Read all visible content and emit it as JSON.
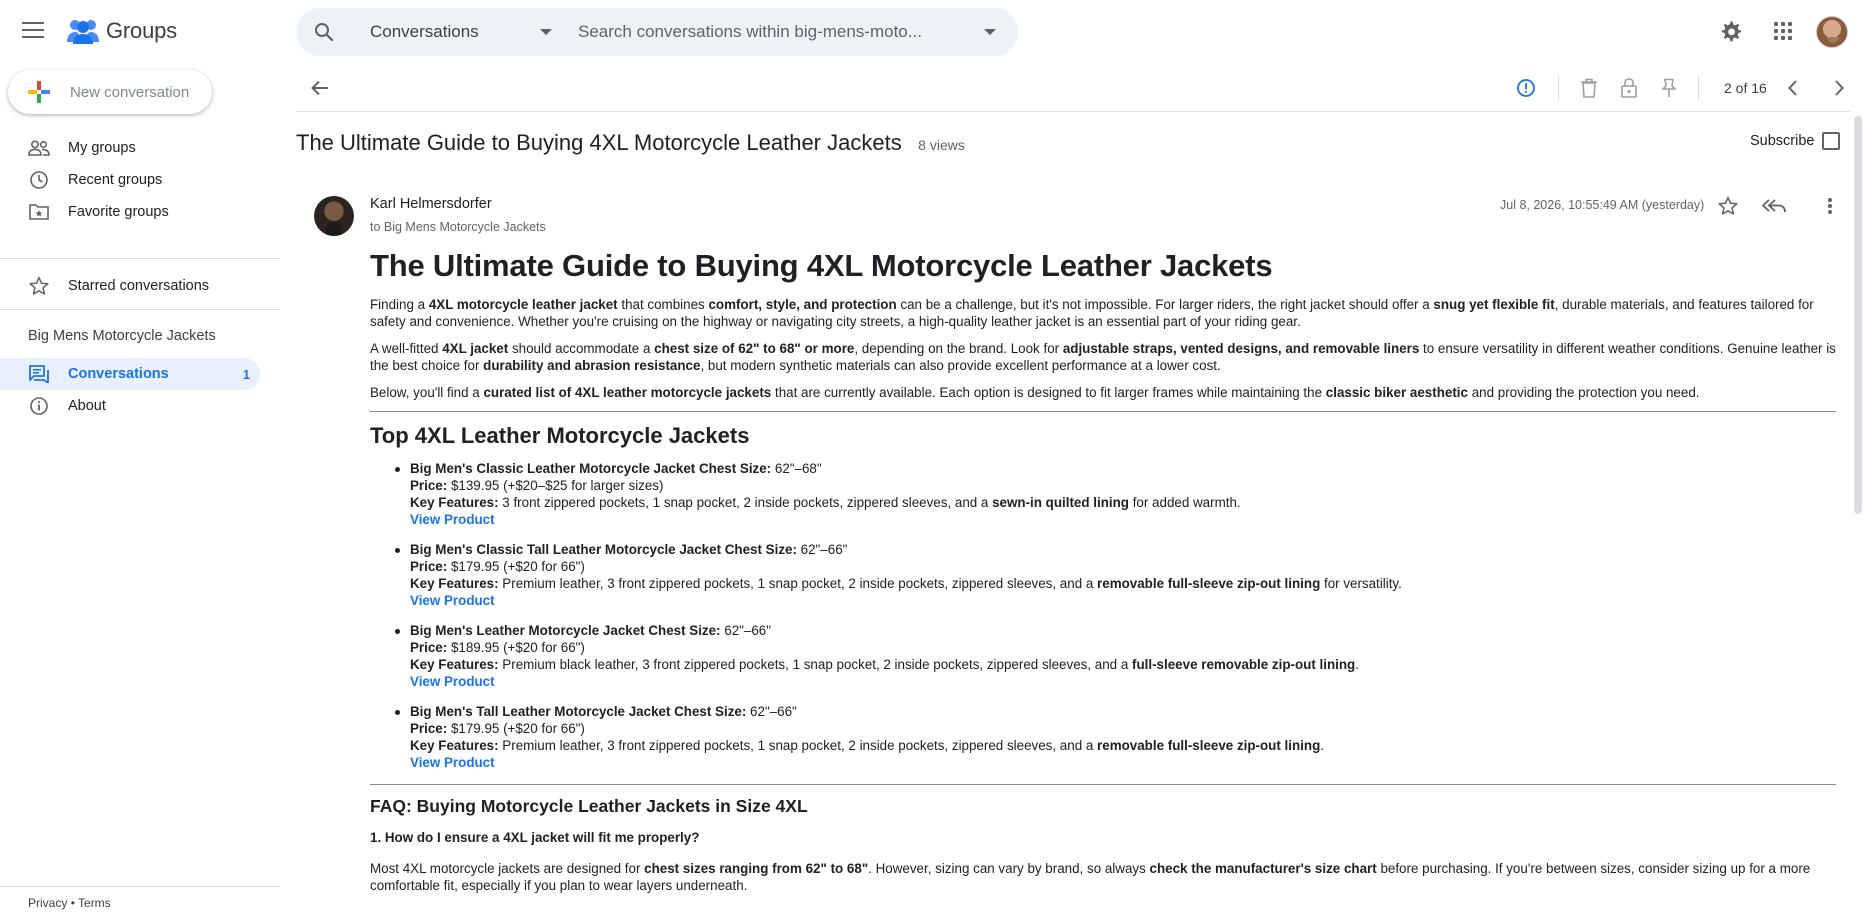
{
  "app": {
    "name": "Groups"
  },
  "search": {
    "scope": "Conversations",
    "placeholder": "Search conversations within big-mens-moto..."
  },
  "sidebar": {
    "new_conversation": "New conversation",
    "items": [
      {
        "label": "My groups",
        "icon": "people-icon"
      },
      {
        "label": "Recent groups",
        "icon": "clock-icon"
      },
      {
        "label": "Favorite groups",
        "icon": "folder-star-icon"
      },
      {
        "label": "Starred conversations",
        "icon": "star-icon"
      }
    ],
    "group_name": "Big Mens Motorcycle Jackets",
    "conversations_label": "Conversations",
    "conversations_count": "1",
    "about_label": "About",
    "footer": {
      "privacy": "Privacy",
      "sep": "•",
      "terms": "Terms"
    }
  },
  "toolbar": {
    "pager": "2 of 16"
  },
  "conversation": {
    "title": "The Ultimate Guide to Buying 4XL Motorcycle Leather Jackets",
    "views": "8 views",
    "subscribe": "Subscribe"
  },
  "message": {
    "author": "Karl Helmersdorfer",
    "to": "to Big Mens Motorcycle Jackets",
    "date": "Jul 8, 2026, 10:55:49 AM (yesterday)",
    "heading": "The Ultimate Guide to Buying 4XL Motorcycle Leather Jackets",
    "p1": {
      "a": "Finding a ",
      "b": "4XL motorcycle leather jacket",
      "c": " that combines ",
      "d": "comfort, style, and protection",
      "e": " can be a challenge, but it's not impossible. For larger riders, the right jacket should offer a ",
      "f": "snug yet flexible fit",
      "g": ", durable materials, and features tailored for safety and convenience. Whether you're cruising on the highway or navigating city streets, a high-quality leather jacket is an essential part of your riding gear."
    },
    "p2": {
      "a": "A well-fitted ",
      "b": "4XL jacket",
      "c": " should accommodate a ",
      "d": "chest size of 62\" to 68\" or more",
      "e": ", depending on the brand. Look for ",
      "f": "adjustable straps, vented designs, and removable liners",
      "g": " to ensure versatility in different weather conditions. Genuine leather is the best choice for ",
      "h": "durability and abrasion resistance",
      "i": ", but modern synthetic materials can also provide excellent performance at a lower cost."
    },
    "p3": {
      "a": "Below, you'll find a ",
      "b": "curated list of 4XL leather motorcycle jackets",
      "c": " that are currently available. Each option is designed to fit larger frames while maintaining the ",
      "d": "classic biker aesthetic",
      "e": " and providing the protection you need."
    },
    "section_title": "Top 4XL Leather Motorcycle Jackets",
    "price_label": "Price:",
    "features_label": "Key Features:",
    "view_product": "View Product",
    "products": [
      {
        "name": "Big Men's Classic Leather Motorcycle Jacket Chest Size:",
        "size": " 62\"–68\"",
        "price": " $139.95 (+$20–$25 for larger sizes)",
        "features": " 3 front zippered pockets, 1 snap pocket, 2 inside pockets, zippered sleeves, and a ",
        "highlight": "sewn-in quilted lining",
        "tail": " for added warmth."
      },
      {
        "name": "Big Men's Classic Tall Leather Motorcycle Jacket Chest Size:",
        "size": " 62\"–66\"",
        "price": " $179.95 (+$20 for 66\")",
        "features": " Premium leather, 3 front zippered pockets, 1 snap pocket, 2 inside pockets, zippered sleeves, and a ",
        "highlight": "removable full-sleeve zip-out lining",
        "tail": " for versatility."
      },
      {
        "name": "Big Men's Leather Motorcycle Jacket Chest Size:",
        "size": " 62\"–66\"",
        "price": " $189.95 (+$20 for 66\")",
        "features": " Premium black leather, 3 front zippered pockets, 1 snap pocket, 2 inside pockets, zippered sleeves, and a ",
        "highlight": "full-sleeve removable zip-out lining",
        "tail": "."
      },
      {
        "name": "Big Men's Tall Leather Motorcycle Jacket Chest Size:",
        "size": " 62\"–66\"",
        "price": " $179.95 (+$20 for 66\")",
        "features": " Premium leather, 3 front zippered pockets, 1 snap pocket, 2 inside pockets, zippered sleeves, and a ",
        "highlight": "removable full-sleeve zip-out lining",
        "tail": "."
      }
    ],
    "faq_title": "FAQ: Buying Motorcycle Leather Jackets in Size 4XL",
    "faq_q1": "1. How do I ensure a 4XL jacket will fit me properly?",
    "faq_a1": {
      "a": "Most 4XL motorcycle jackets are designed for ",
      "b": "chest sizes ranging from 62\" to 68\"",
      "c": ". However, sizing can vary by brand, so always ",
      "d": "check the manufacturer's size chart",
      "e": " before purchasing. If you're between sizes, consider sizing up for a more comfortable fit, especially if you plan to wear layers underneath."
    }
  },
  "colors": {
    "accent": "#1a73e8",
    "active_bg": "#e8f0fe",
    "search_bg": "#eef1f6",
    "text": "#202124",
    "muted": "#5f6368"
  }
}
